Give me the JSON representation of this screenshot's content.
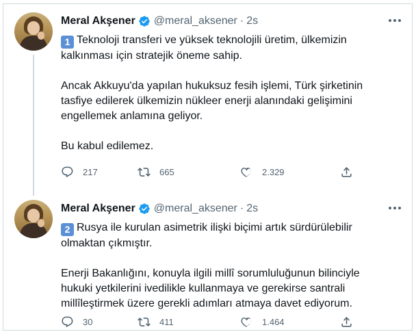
{
  "tweets": [
    {
      "name": "Meral Akşener",
      "handle": "@meral_aksener",
      "separator": "·",
      "time": "2s",
      "number": "1",
      "text": "Teknoloji transferi ve yüksek teknolojili üretim, ülkemizin kalkınması için stratejik öneme sahip.\n\nAncak Akkuyu'da yapılan hukuksuz fesih işlemi, Türk şirketinin tasfiye edilerek ülkemizin nükleer enerji alanındaki gelişimini engellemek anlamına geliyor.\n\nBu kabul edilemez.",
      "replies": "217",
      "retweets": "665",
      "likes": "2.329",
      "icons": [
        "reply-icon",
        "retweet-icon",
        "like-icon",
        "share-icon"
      ]
    },
    {
      "name": "Meral Akşener",
      "handle": "@meral_aksener",
      "separator": "·",
      "time": "2s",
      "number": "2",
      "text": "Rusya ile kurulan asimetrik ilişki biçimi artık sürdürülebilir olmaktan çıkmıştır.\n\nEnerji Bakanlığını, konuyla ilgili millî sorumluluğunun bilinciyle hukuki yetkilerini ivedilikle kullanmaya ve gerekirse santrali millîleştirmek üzere gerekli adımları atmaya davet ediyorum.",
      "replies": "30",
      "retweets": "411",
      "likes": "1.464",
      "icons": [
        "reply-icon",
        "retweet-icon",
        "like-icon",
        "share-icon"
      ]
    }
  ],
  "colors": {
    "verified": "#1d9bf0",
    "secondary": "#536471",
    "divider": "#cfd9de",
    "keycap": "#5b8fd6"
  }
}
